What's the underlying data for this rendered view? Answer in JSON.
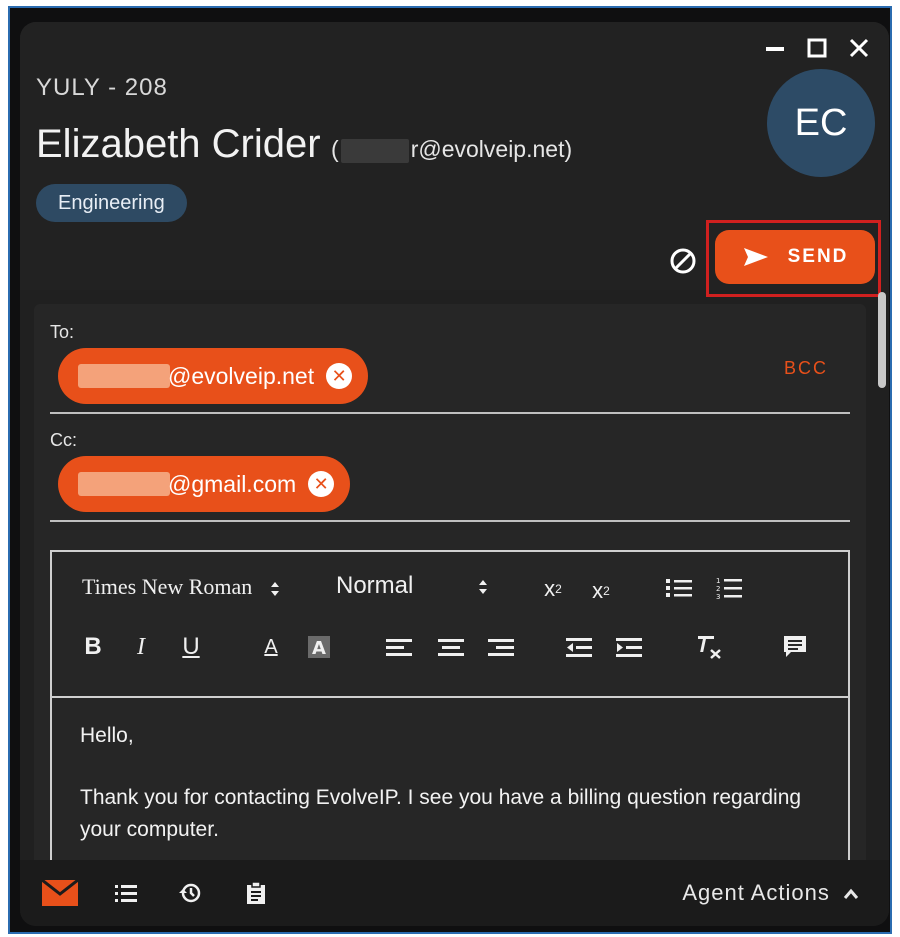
{
  "header": {
    "queue_label": "YULY - 208",
    "contact_name": "Elizabeth Crider",
    "email_open": "(",
    "email_visible": "r@evolveip.net)",
    "department_tag": "Engineering",
    "avatar_initials": "EC"
  },
  "window_controls": [
    "minimize-icon",
    "maximize-icon",
    "close-icon"
  ],
  "send_button": {
    "label": "SEND",
    "color": "#e8501a"
  },
  "compose": {
    "to_label": "To:",
    "to_chip": "@evolveip.net",
    "bcc_label": "BCC",
    "cc_label": "Cc:",
    "cc_chip": "@gmail.com"
  },
  "toolbar": {
    "font_family": "Times New Roman",
    "font_size": "Normal",
    "buttons": [
      "superscript",
      "subscript",
      "bullet-list",
      "numbered-list",
      "bold",
      "italic",
      "underline",
      "font-color",
      "background-color",
      "align-left",
      "align-center",
      "align-right",
      "outdent",
      "indent",
      "clear-format",
      "comment"
    ]
  },
  "message": {
    "greeting": "Hello,",
    "body": "Thank you for contacting EvolveIP.  I see you have a billing question regarding your computer."
  },
  "bottom_bar": {
    "icons": [
      "email-icon",
      "list-icon",
      "history-icon",
      "clipboard-icon"
    ],
    "agent_actions_label": "Agent Actions"
  },
  "colors": {
    "accent": "#e8501a",
    "avatar": "#2d4b66",
    "tag": "#2e4a63",
    "background": "#202020"
  }
}
